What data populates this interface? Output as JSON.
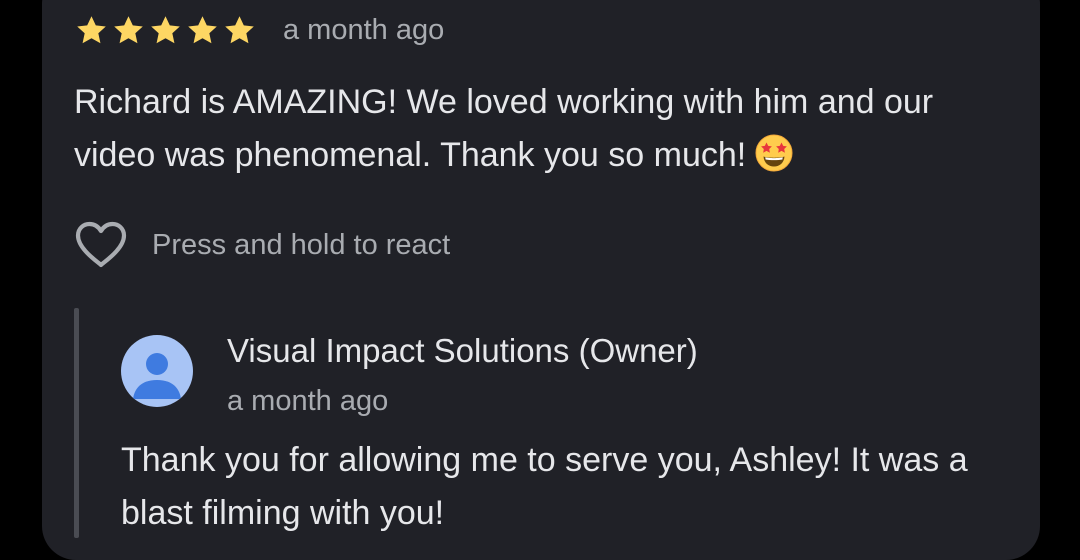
{
  "review": {
    "rating": 5,
    "rating_max": 5,
    "time_ago": "a month ago",
    "text": "Richard is AMAZING! We loved working with him and our video was phenomenal. Thank you so much!",
    "emoji_icon": "star-struck-emoji-icon",
    "react_label": "Press and hold to react",
    "react_icon": "heart-outline-icon"
  },
  "reply": {
    "author": "Visual Impact Solutions (Owner)",
    "avatar_icon": "default-person-avatar-icon",
    "time_ago": "a month ago",
    "text": "Thank you for allowing me to serve you, Ashley! It was a blast filming with you!"
  },
  "colors": {
    "card_background": "#202127",
    "star": "#fdd663",
    "primary_text": "#e6e7ea",
    "secondary_text": "#a9acb1",
    "avatar_background": "#a8c4f5",
    "avatar_figure": "#3f7be0"
  }
}
